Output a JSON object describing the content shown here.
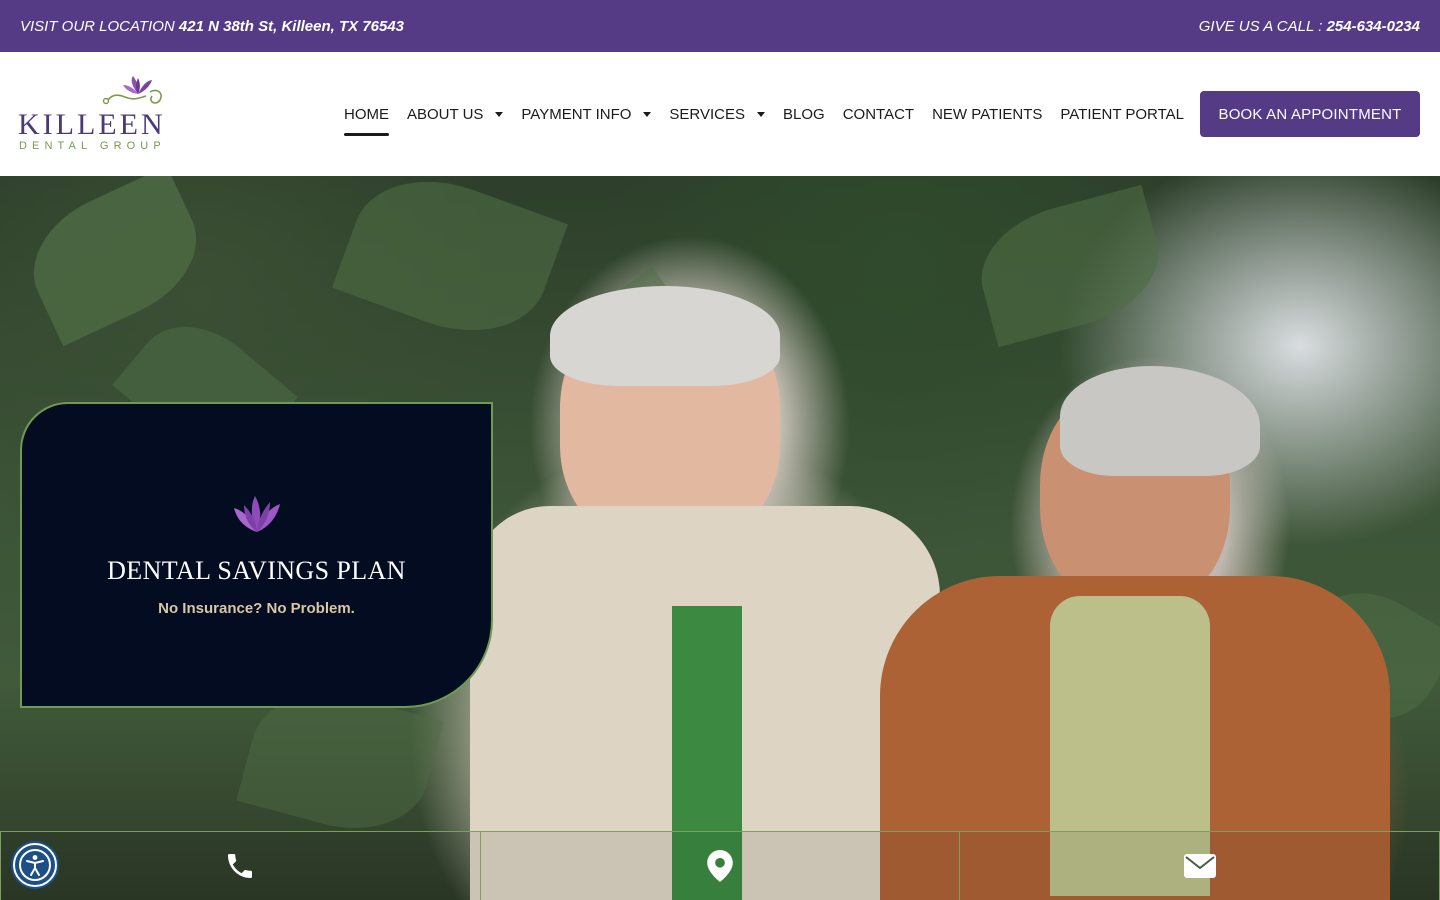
{
  "topbar": {
    "location_prefix": "VISIT OUR LOCATION",
    "location_address": "421 N 38th St, Killeen, TX 76543",
    "phone_prefix": "GIVE US A CALL :",
    "phone_number": "254-634-0234"
  },
  "logo": {
    "wordmark": "KILLEEN",
    "subline": "DENTAL GROUP"
  },
  "nav": {
    "home": "HOME",
    "about": "ABOUT US",
    "payment": "PAYMENT INFO",
    "services": "SERVICES",
    "blog": "BLOG",
    "contact": "CONTACT",
    "new_patients": "NEW PATIENTS",
    "patient_portal": "PATIENT PORTAL",
    "active": "HOME"
  },
  "cta": {
    "book_label": "BOOK AN APPOINTMENT"
  },
  "promo": {
    "title": "DENTAL SAVINGS PLAN",
    "subtitle": "No Insurance? No Problem."
  },
  "contact_bar": {
    "icons": [
      "phone-icon",
      "map-pin-icon",
      "envelope-icon"
    ]
  },
  "colors": {
    "brand_purple": "#553b86",
    "brand_green": "#6f9a53",
    "card_navy": "#040c21",
    "accent_gold": "#d7c7a4"
  }
}
